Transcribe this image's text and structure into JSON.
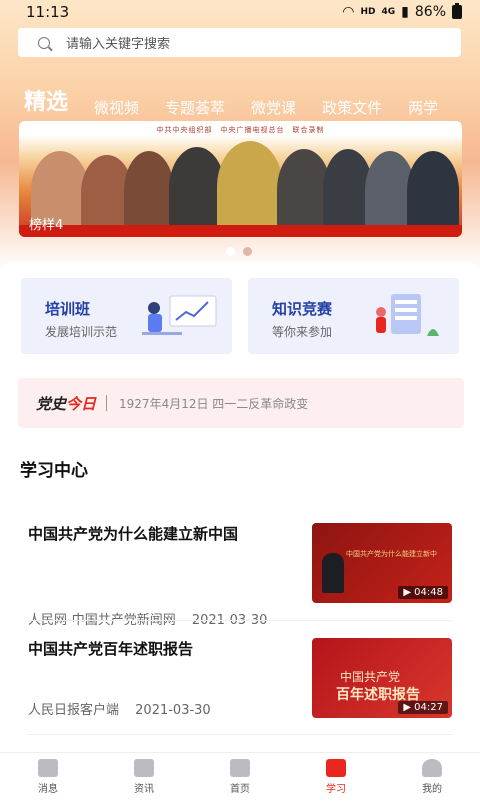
{
  "status_bar": {
    "time": "11:13",
    "network": "HD",
    "signal": "4G",
    "battery": "86%"
  },
  "search": {
    "placeholder": "请输入关键字搜索"
  },
  "tabs": [
    {
      "label": "精选"
    },
    {
      "label": "微视频"
    },
    {
      "label": "专题荟萃"
    },
    {
      "label": "微党课"
    },
    {
      "label": "政策文件"
    },
    {
      "label": "两学"
    }
  ],
  "banner": {
    "credits": "中共中央组织部　中央广播电视总台　联合录制",
    "caption": "榜样4",
    "page_count": 2,
    "active_page": 1
  },
  "cards": [
    {
      "title": "培训班",
      "subtitle": "发展培训示范"
    },
    {
      "title": "知识竞赛",
      "subtitle": "等你来参加"
    }
  ],
  "today": {
    "logo_a": "党史",
    "logo_b": "今日",
    "text": "1927年4月12日 四一二反革命政变"
  },
  "study_center": {
    "title": "学习中心",
    "items": [
      {
        "headline": "中国共产党为什么能建立新中国",
        "source": "人民网-中国共产党新闻网",
        "date": "2021-03-30",
        "duration": "▶ 04:48",
        "thumb_text": "中国共产党为什么能建立新中"
      },
      {
        "headline": "中国共产党百年述职报告",
        "source": "人民日报客户端",
        "date": "2021-03-30",
        "duration": "▶ 04:27",
        "thumb_text_1": "中国共产党",
        "thumb_text_2": "百年述职报告"
      }
    ]
  },
  "bottom_nav": [
    {
      "label": "消息"
    },
    {
      "label": "资讯"
    },
    {
      "label": "首页"
    },
    {
      "label": "学习"
    },
    {
      "label": "我的"
    }
  ],
  "colors": {
    "accent": "#e8281f",
    "card_blue": "#2440a8"
  }
}
